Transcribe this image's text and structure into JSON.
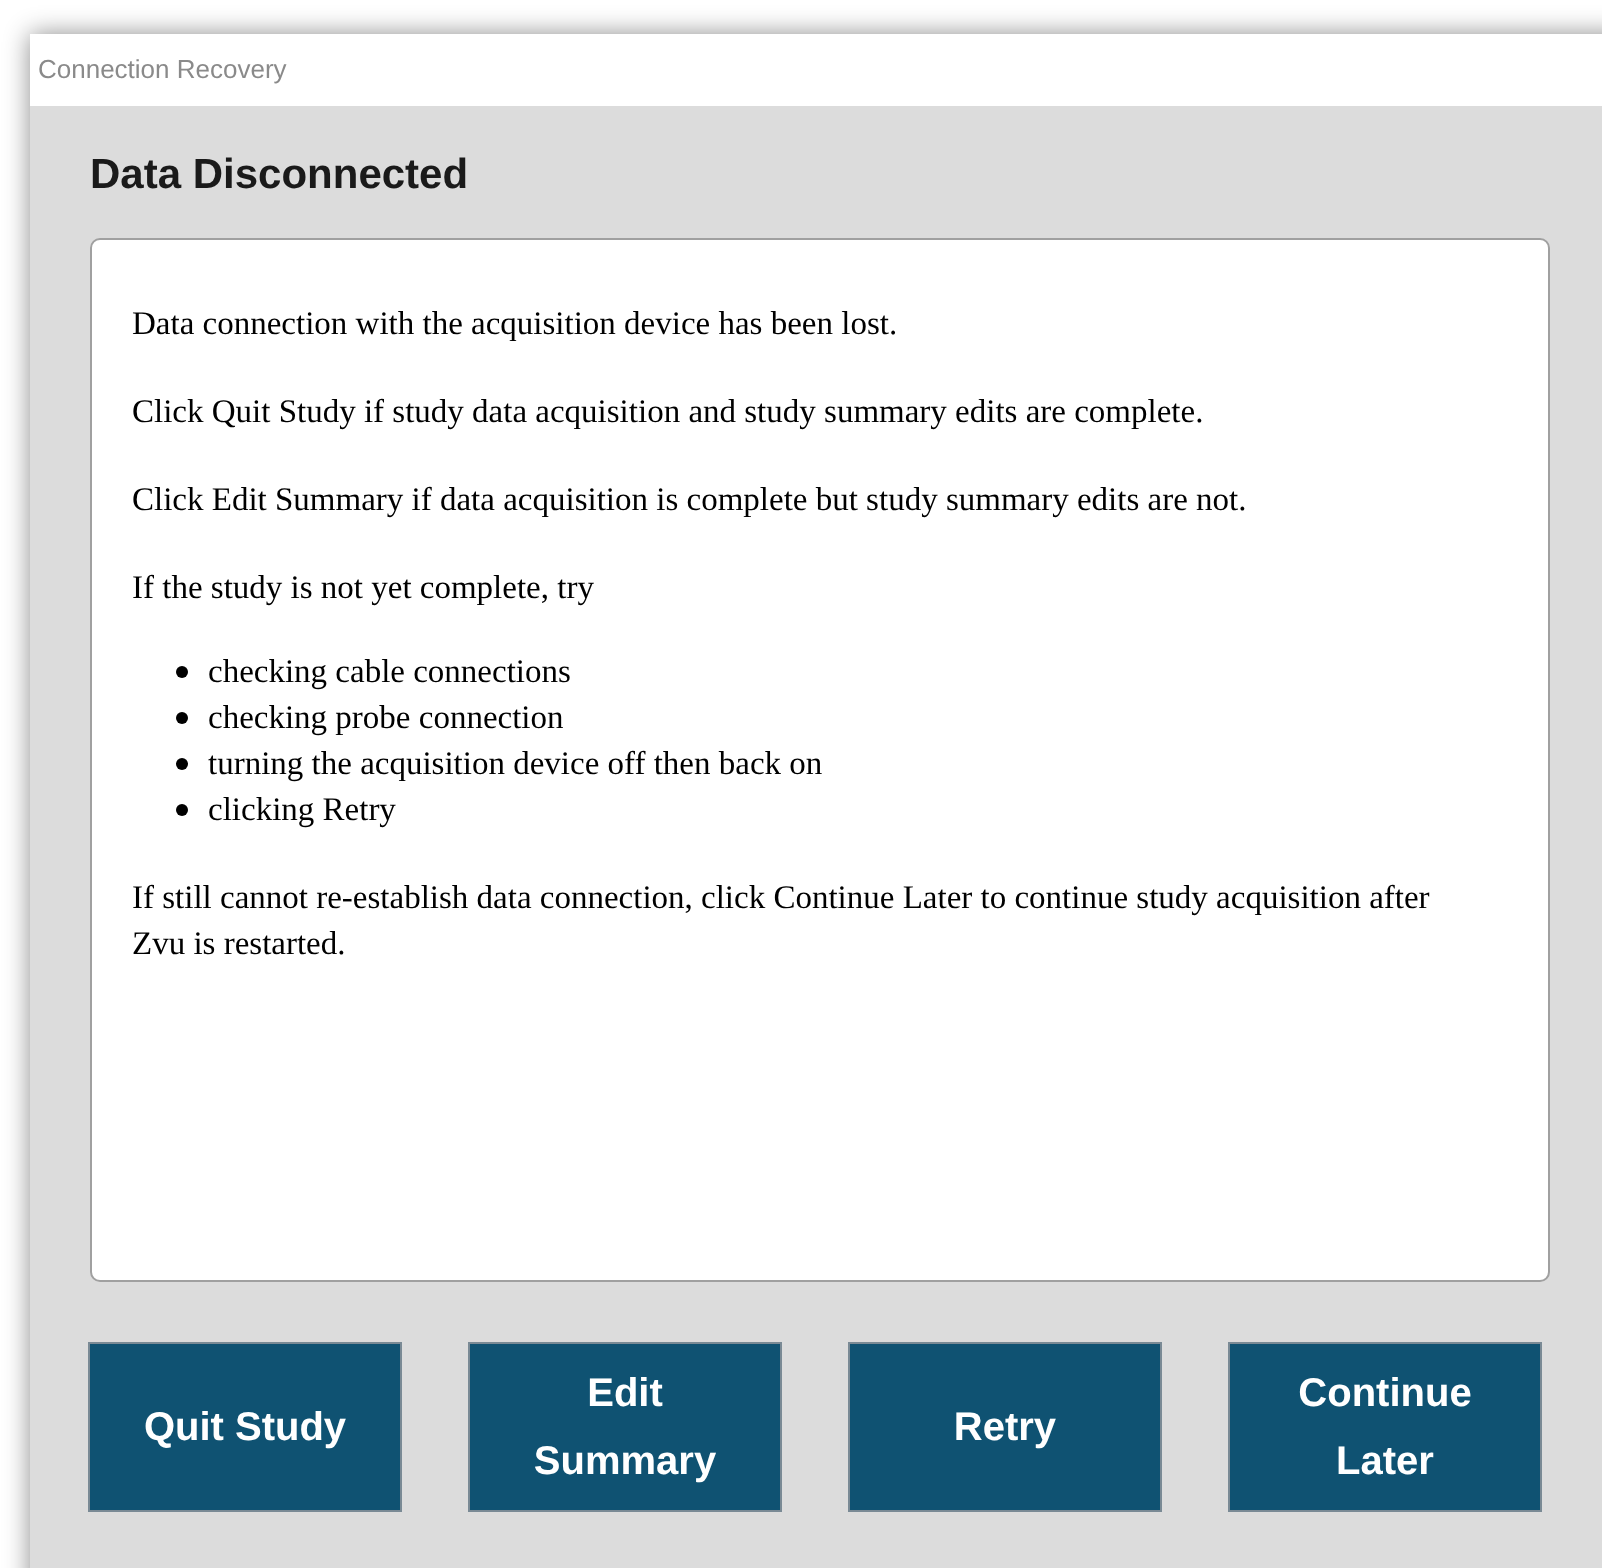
{
  "window": {
    "title": "Connection Recovery"
  },
  "heading": "Data Disconnected",
  "message": {
    "paragraphs_before": [
      "Data connection with the acquisition device has been lost.",
      "Click Quit Study if study data acquisition and study summary edits are complete.",
      "Click Edit Summary if data acquisition is complete but study summary edits are not.",
      "If the study is not yet complete, try"
    ],
    "bullets": [
      "checking cable connections",
      "checking probe connection",
      "turning the acquisition device off then back on",
      "clicking Retry"
    ],
    "paragraphs_after": [
      "If still cannot re-establish data connection, click Continue Later to continue study acquisition after Zvu is restarted."
    ]
  },
  "buttons": [
    "Quit Study",
    "Edit Summary",
    "Retry",
    "Continue Later"
  ]
}
